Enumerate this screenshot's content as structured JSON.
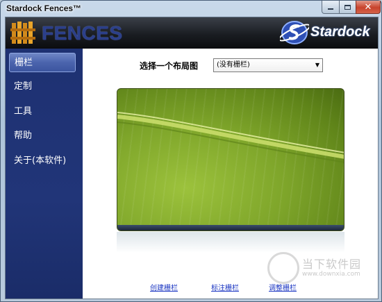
{
  "window": {
    "title": "Stardock Fences™",
    "controls": {
      "minimize": "minimize-icon",
      "maximize": "maximize-icon",
      "close": "close-icon"
    }
  },
  "banner": {
    "product_name": "FENCES",
    "company": "Stardock"
  },
  "sidebar": {
    "items": [
      {
        "label": "栅栏",
        "active": true
      },
      {
        "label": "定制",
        "active": false
      },
      {
        "label": "工具",
        "active": false
      },
      {
        "label": "帮助",
        "active": false
      },
      {
        "label": "关于(本软件)",
        "active": false
      }
    ]
  },
  "main": {
    "layout_label": "选择一个布局图",
    "layout_select": {
      "selected": "(没有栅栏)"
    },
    "links": [
      "创建栅栏",
      "标注栅栏",
      "调整栅栏"
    ]
  },
  "watermark": {
    "text": "当下软件园",
    "url": "www.downxia.com"
  },
  "colors": {
    "sidebar_bg": "#213578",
    "banner_bg": "#1a1d22",
    "link": "#1a35c2",
    "preview_green": "#7ea52a"
  }
}
